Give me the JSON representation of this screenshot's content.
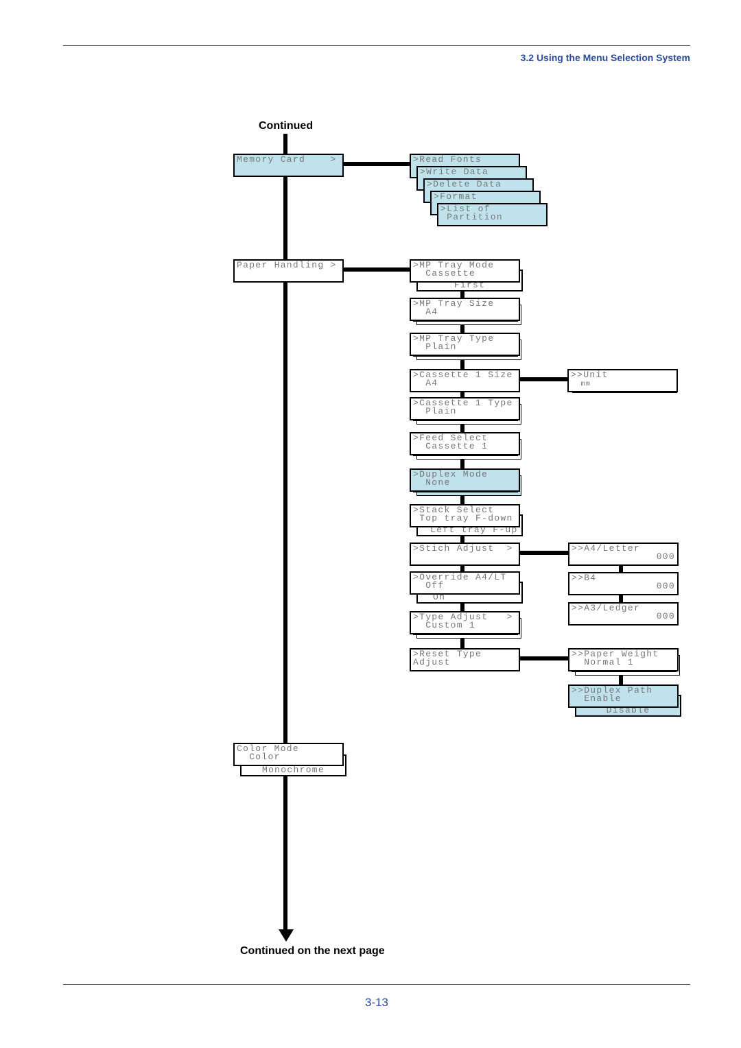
{
  "header": {
    "section": "3.2 Using the Menu Selection System"
  },
  "labels": {
    "continued": "Continued",
    "continued_next": "Continued on the next page"
  },
  "footer": {
    "page_number": "3-13"
  },
  "colors": {
    "highlight": "#bfe2ec",
    "accent": "#2a4a9a"
  },
  "menu": {
    "memory_card": {
      "l1": "Memory Card    >"
    },
    "read_fonts": {
      "l1": ">Read Fonts"
    },
    "write_data": {
      "l1": ">Write Data"
    },
    "delete_data": {
      "l1": ">Delete Data"
    },
    "format": {
      "l1": ">Format"
    },
    "list_partition": {
      "l1": ">List of",
      "l2": " Partition"
    },
    "paper_handling": {
      "l1": "Paper Handling >"
    },
    "mp_tray_mode": {
      "l1": ">MP Tray Mode",
      "l2": "  Cassette",
      "opt": "First"
    },
    "mp_tray_size": {
      "l1": ">MP Tray Size",
      "l2": "  A4"
    },
    "mp_tray_type": {
      "l1": ">MP Tray Type",
      "l2": "  Plain"
    },
    "cassette1_size": {
      "l1": ">Cassette 1 Size",
      "l2": "  A4"
    },
    "unit": {
      "l1": ">>Unit",
      "l2": "  mm"
    },
    "cassette1_type": {
      "l1": ">Cassette 1 Type",
      "l2": "  Plain"
    },
    "feed_select": {
      "l1": ">Feed Select",
      "l2": "  Cassette 1"
    },
    "duplex_mode": {
      "l1": ">Duplex Mode",
      "l2": "  None"
    },
    "stack_select": {
      "l1": ">Stack Select",
      "l2": " Top tray F-down",
      "opt": "  Left tray F-up"
    },
    "stich_adjust": {
      "l1": ">Stich Adjust  >"
    },
    "a4_letter": {
      "l1": ">>A4/Letter",
      "l2": "000"
    },
    "override": {
      "l1": ">Override A4/LT",
      "l2": "  Off",
      "opt": "On"
    },
    "b4": {
      "l1": ">>B4",
      "l2": "000"
    },
    "a3_ledger": {
      "l1": ">>A3/Ledger",
      "l2": "000"
    },
    "type_adjust": {
      "l1": ">Type Adjust   >",
      "l2": "  Custom 1"
    },
    "reset_type": {
      "l1": ">Reset Type",
      "l2": "Adjust"
    },
    "paper_weight": {
      "l1": ">>Paper Weight",
      "l2": "  Normal 1"
    },
    "duplex_path": {
      "l1": ">>Duplex Path",
      "l2": "  Enable",
      "opt": "Disable"
    },
    "color_mode": {
      "l1": "Color Mode",
      "l2": "  Color",
      "opt": "Monochrome"
    }
  }
}
